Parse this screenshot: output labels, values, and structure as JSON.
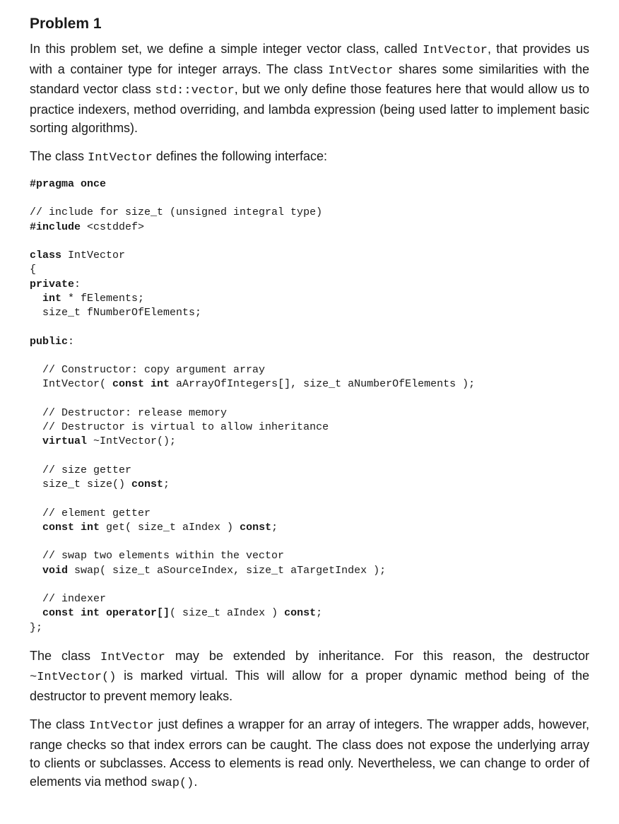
{
  "heading": "Problem 1",
  "p1": {
    "t1": "In this problem set, we define a simple integer vector class, called ",
    "c1": "IntVector",
    "t2": ", that provides us with a container type for integer arrays. The class ",
    "c2": "IntVector",
    "t3": " shares some similarities with the standard vector class ",
    "c3": "std::vector",
    "t4": ", but we only define those features here that would allow us to practice indexers, method overriding, and lambda expression (being used latter to implement basic sorting algorithms)."
  },
  "p2": {
    "t1": "The class ",
    "c1": "IntVector",
    "t2": " defines the following interface:"
  },
  "code": {
    "l01b": "#pragma once",
    "l02": "",
    "l03": "// include for size_t (unsigned integral type)",
    "l04a": "#include ",
    "l04b": "<cstddef>",
    "l05": "",
    "l06a": "class ",
    "l06b": "IntVector",
    "l07": "{",
    "l08b": "private",
    "l08c": ":",
    "l09a": "  ",
    "l09b": "int",
    "l09c": " * fElements;",
    "l10": "  size_t fNumberOfElements;",
    "l11": "",
    "l12b": "public",
    "l12c": ":",
    "l13": "",
    "l14": "  // Constructor: copy argument array",
    "l15a": "  IntVector( ",
    "l15b": "const int",
    "l15c": " aArrayOfIntegers[], size_t aNumberOfElements );",
    "l16": "",
    "l17": "  // Destructor: release memory",
    "l18": "  // Destructor is virtual to allow inheritance",
    "l19a": "  ",
    "l19b": "virtual",
    "l19c": " ~IntVector();",
    "l20": "",
    "l21": "  // size getter",
    "l22a": "  size_t size() ",
    "l22b": "const",
    "l22c": ";",
    "l23": "",
    "l24": "  // element getter",
    "l25a": "  ",
    "l25b": "const int",
    "l25c": " get( size_t aIndex ) ",
    "l25d": "const",
    "l25e": ";",
    "l26": "",
    "l27": "  // swap two elements within the vector",
    "l28a": "  ",
    "l28b": "void",
    "l28c": " swap( size_t aSourceIndex, size_t aTargetIndex );",
    "l29": "",
    "l30": "  // indexer",
    "l31a": "  ",
    "l31b": "const int operator[]",
    "l31c": "( size_t aIndex ) ",
    "l31d": "const",
    "l31e": ";",
    "l32": "};"
  },
  "p3": {
    "t1": "The class ",
    "c1": "IntVector",
    "t2": " may be extended by inheritance. For this reason, the destructor ",
    "c2": "~IntVector()",
    "t3": " is marked virtual. This will allow for a proper dynamic method being of the destructor to prevent memory leaks."
  },
  "p4": {
    "t1": "The class ",
    "c1": "IntVector",
    "t2": " just defines a wrapper for an array of integers. The wrapper adds, however, range checks so that index errors can be caught. The class does not expose the underlying array to clients or subclasses. Access to elements is read only. Nevertheless, we can change to order of elements via method ",
    "c2": "swap()",
    "t3": "."
  }
}
